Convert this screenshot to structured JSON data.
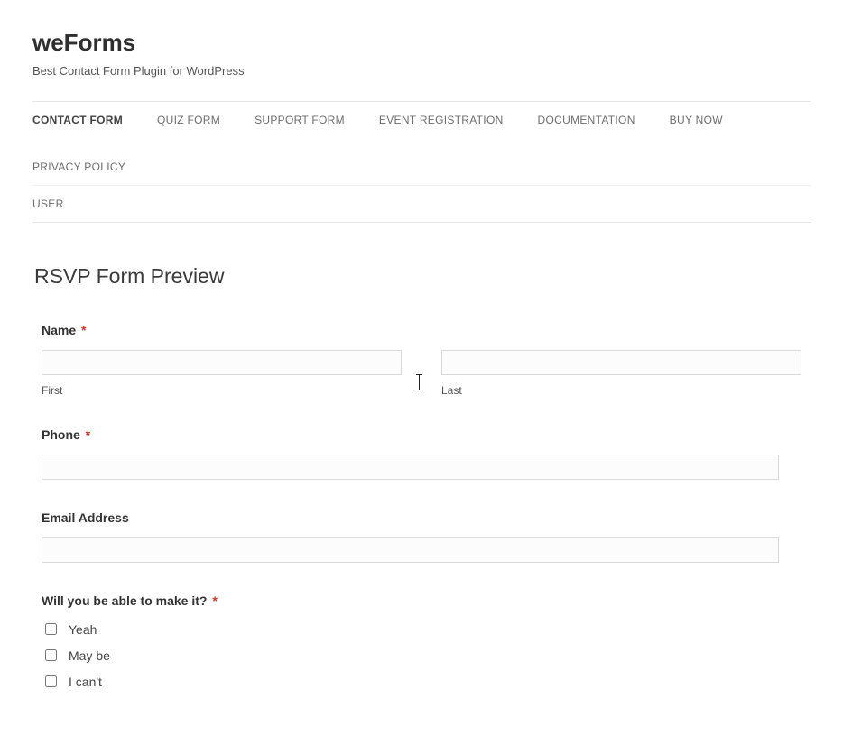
{
  "header": {
    "title": "weForms",
    "tagline": "Best Contact Form Plugin for WordPress"
  },
  "nav": {
    "items": [
      "CONTACT FORM",
      "QUIZ FORM",
      "SUPPORT FORM",
      "EVENT REGISTRATION",
      "DOCUMENTATION",
      "BUY NOW",
      "PRIVACY POLICY",
      "USER"
    ]
  },
  "preview_title": "RSVP Form Preview",
  "form": {
    "name": {
      "label": "Name",
      "first_sub": "First",
      "last_sub": "Last",
      "first_value": "",
      "last_value": ""
    },
    "phone": {
      "label": "Phone",
      "value": ""
    },
    "email": {
      "label": "Email Address",
      "value": ""
    },
    "attend": {
      "label": "Will you be able to make it?",
      "options": [
        "Yeah",
        "May be",
        "I can't"
      ]
    }
  },
  "required_marker": "*"
}
